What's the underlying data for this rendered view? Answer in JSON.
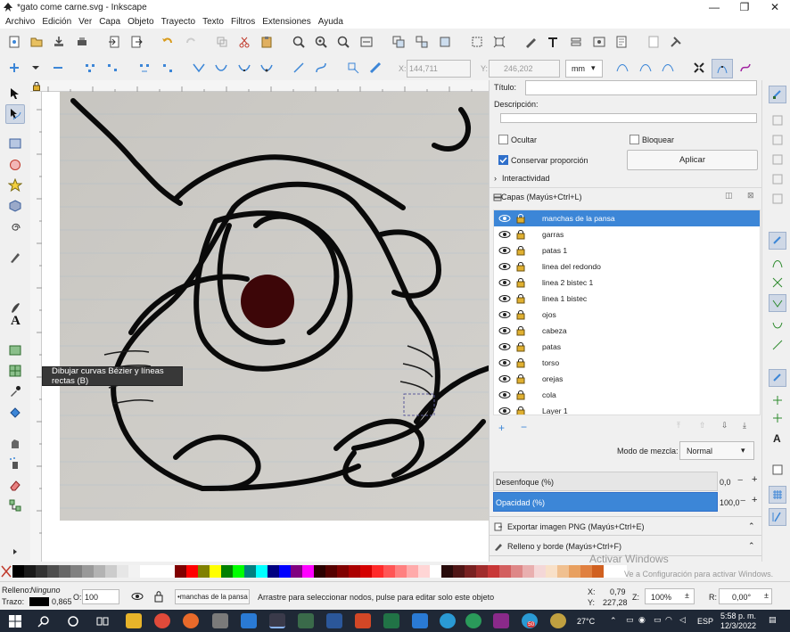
{
  "window": {
    "title": "*gato come carne.svg - Inkscape",
    "controls": [
      "—",
      "❐",
      "✕"
    ]
  },
  "menu": [
    "Archivo",
    "Edición",
    "Ver",
    "Capa",
    "Objeto",
    "Trayecto",
    "Texto",
    "Filtros",
    "Extensiones",
    "Ayuda"
  ],
  "controls": {
    "x_label": "X:",
    "x_value": "144,711",
    "y_label": "Y:",
    "y_value": "246,202",
    "unit": "mm"
  },
  "tooltip": "Dibujar curvas Bézier y líneas rectas (B)",
  "object_props": {
    "title_label": "Título:",
    "desc_label": "Descripción:",
    "hide_label": "Ocultar",
    "lock_label": "Bloquear",
    "keep_ratio_label": "Conservar proporción",
    "apply_label": "Aplicar",
    "interactivity_label": "Interactividad"
  },
  "layers_panel": {
    "title": "Capas (Mayús+Ctrl+L)",
    "layers": [
      "manchas de la pansa",
      "garras",
      "patas 1",
      "linea del redondo",
      "linea 2 bistec 1",
      "linea 1 bistec",
      "ojos",
      "cabeza",
      "patas",
      "torso",
      "orejas",
      "cola",
      "Layer 1"
    ],
    "selected_index": 0,
    "blend_label": "Modo de mezcla:",
    "blend_value": "Normal",
    "blur_label": "Desenfoque (%)",
    "blur_value": "0,0",
    "opacity_label": "Opacidad (%)",
    "opacity_value": "100,0"
  },
  "export_panel": {
    "title": "Exportar imagen PNG (Mayús+Ctrl+E)"
  },
  "fill_panel": {
    "title": "Relleno y borde (Mayús+Ctrl+F)"
  },
  "watermark": {
    "line1": "Activar Windows",
    "line2": "Ve a Configuración para activar Windows."
  },
  "status": {
    "fill_label": "Relleno:",
    "fill_value": "Ninguno",
    "stroke_label": "Trazo:",
    "stroke_width": "0,865",
    "opacity_label": "O:",
    "opacity_value": "100",
    "layer_value": "•manchas de la pansa",
    "message": "Arrastre para seleccionar nodos, pulse para editar solo este objeto",
    "x_label": "X:",
    "x_value": "0,79",
    "y_label": "Y:",
    "y_value": "227,28",
    "zoom_label": "Z:",
    "zoom_value": "100%",
    "rot_label": "R:",
    "rot_value": "0,00°"
  },
  "taskbar": {
    "weather": "27°C",
    "lang": "ESP",
    "time": "5:58 p. m.",
    "date": "12/3/2022",
    "badge": "50"
  },
  "colors": {
    "accent": "#3c86d7",
    "selected_layer": "#3c86d7",
    "eye_fill": "#5c1012",
    "taskbar": "#1f2836"
  }
}
